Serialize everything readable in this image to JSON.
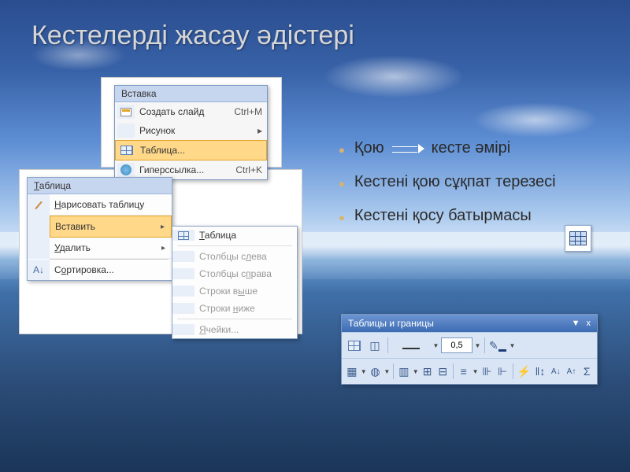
{
  "title": "Кестелерді жасау әдістері",
  "bullets": [
    {
      "text_a": "Қою",
      "text_b": "кесте әмірі",
      "has_arrow": true
    },
    {
      "text": "Кестені қою сұқпат терезесі"
    },
    {
      "text": "Кестені қосу батырмасы"
    }
  ],
  "menu1": {
    "header": "Вставка",
    "items": [
      {
        "icon": "slide-icon",
        "label": "Создать слайд",
        "shortcut": "Ctrl+M"
      },
      {
        "icon": "blank-icon",
        "label": "Рисунок",
        "arrow": true
      },
      {
        "icon": "table-icon",
        "label": "Таблица...",
        "selected": true
      },
      {
        "icon": "globe-icon",
        "label": "Гиперссылка...",
        "shortcut": "Ctrl+K"
      }
    ]
  },
  "menu2": {
    "header": "Таблица",
    "items": [
      {
        "icon": "pencil-icon",
        "label_u": "Н",
        "label_rest": "арисовать таблицу"
      },
      {
        "label": "Вставить",
        "arrow": true,
        "selected": true
      },
      {
        "label_u": "У",
        "label_rest": "далить",
        "arrow": true
      },
      {
        "icon": "sort-icon",
        "label": "Сортировка..."
      }
    ]
  },
  "submenu": {
    "items": [
      {
        "icon": "table-icon",
        "label_u": "Т",
        "label_rest": "аблица",
        "active": true
      },
      {
        "label": "Столбцы с",
        "label_u": "л",
        "label_rest2": "ева"
      },
      {
        "label": "Столбцы с",
        "label_u": "п",
        "label_rest2": "рава"
      },
      {
        "label": "Строки в",
        "label_u": "ы",
        "label_rest2": "ше"
      },
      {
        "label": "Строки ",
        "label_u": "н",
        "label_rest2": "иже"
      },
      {
        "label_u": "Я",
        "label_rest": "чейки..."
      }
    ]
  },
  "toolbar": {
    "title": "Таблицы и границы",
    "close_min": "▼",
    "close_x": "x",
    "line_width": "0,5",
    "row2_sigma": "Σ"
  }
}
